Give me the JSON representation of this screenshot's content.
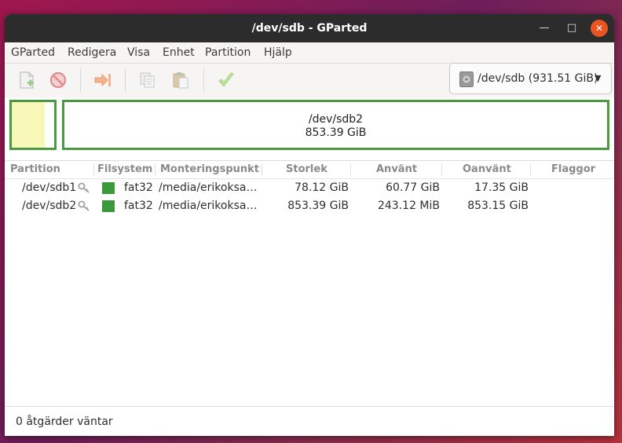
{
  "window": {
    "title": "/dev/sdb - GParted"
  },
  "menubar": {
    "items": [
      "GParted",
      "Redigera",
      "Visa",
      "Enhet",
      "Partition",
      "Hjälp"
    ]
  },
  "toolbar": {
    "buttons": [
      {
        "icon": "new-partition-icon"
      },
      {
        "icon": "delete-icon"
      },
      {
        "icon": "resize-move-icon"
      },
      {
        "icon": "copy-icon"
      },
      {
        "icon": "paste-icon"
      },
      {
        "icon": "apply-check-icon"
      }
    ]
  },
  "device": {
    "label": "/dev/sdb (931.51 GiB)",
    "icon": "harddisk-icon"
  },
  "diskmap": {
    "partitions": [
      {
        "name": "/dev/sdb1",
        "used_fraction": 0.78
      },
      {
        "name": "/dev/sdb2",
        "size": "853.39 GiB"
      }
    ],
    "border_color": "#4b9a41",
    "used_color": "#f7f7b8"
  },
  "table": {
    "headers": [
      "Partition",
      "Filsystem",
      "Monteringspunkt",
      "Storlek",
      "Använt",
      "Oanvänt",
      "Flaggor"
    ],
    "rows": [
      {
        "partition": "/dev/sdb1",
        "fs": "fat32",
        "mount": "/media/erikoksa…",
        "size": "78.12 GiB",
        "used": "60.77 GiB",
        "unused": "17.35 GiB",
        "flags": ""
      },
      {
        "partition": "/dev/sdb2",
        "fs": "fat32",
        "mount": "/media/erikoksa…",
        "size": "853.39 GiB",
        "used": "243.12 MiB",
        "unused": "853.15 GiB",
        "flags": ""
      }
    ],
    "fs_color": "#3c9a3c"
  },
  "status": {
    "text": "0 åtgärder väntar"
  }
}
